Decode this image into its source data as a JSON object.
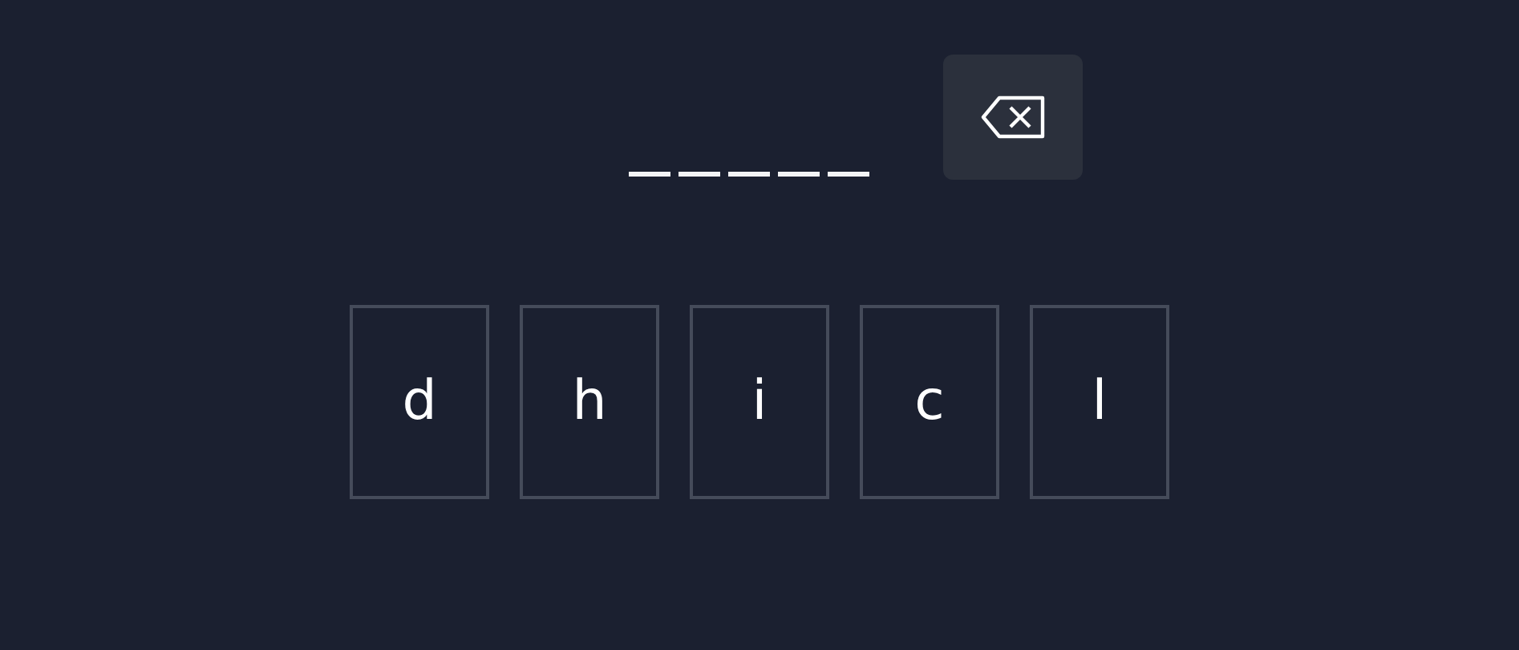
{
  "answer_slots": [
    {
      "filled": false
    },
    {
      "filled": false
    },
    {
      "filled": false
    },
    {
      "filled": false
    },
    {
      "filled": false
    }
  ],
  "backspace_button": {
    "disabled": false
  },
  "letter_tiles": [
    {
      "letter": "d",
      "used": false
    },
    {
      "letter": "h",
      "used": false
    },
    {
      "letter": "i",
      "used": false
    },
    {
      "letter": "c",
      "used": false
    },
    {
      "letter": "l",
      "used": false
    }
  ]
}
